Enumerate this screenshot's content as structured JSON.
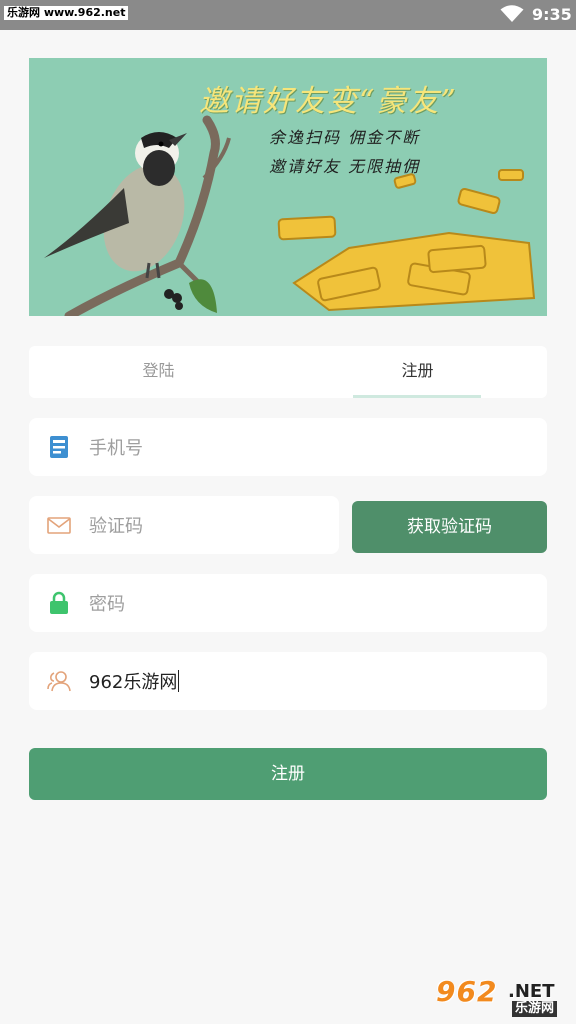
{
  "status_bar": {
    "watermark_text": "乐游网 www.962.net",
    "time": "9:35",
    "icons": [
      "wifi-icon"
    ]
  },
  "banner": {
    "title": "邀请好友变“豪友”",
    "line1": "余逸扫码 佣金不断",
    "line2": "邀请好友 无限抽佣",
    "colors": {
      "background": "#8dcdb3",
      "title": "#f6e57a"
    }
  },
  "tabs": [
    {
      "label": "登陆",
      "active": false
    },
    {
      "label": "注册",
      "active": true
    }
  ],
  "form": {
    "phone": {
      "placeholder": "手机号",
      "value": "",
      "icon": "phone-icon"
    },
    "code": {
      "placeholder": "验证码",
      "value": "",
      "icon": "mail-icon"
    },
    "password": {
      "placeholder": "密码",
      "value": "",
      "icon": "lock-icon"
    },
    "inviter": {
      "placeholder": "",
      "value": "962乐游网",
      "icon": "users-icon"
    },
    "get_code_label": "获取验证码",
    "submit_label": "注册"
  },
  "watermark": {
    "number": "962",
    "net": ".NET",
    "sub": "乐游网"
  },
  "colors": {
    "accent": "#4f9e73",
    "code_button": "#4f8f6a",
    "tab_indicator": "#cfe9df",
    "background": "#f7f7f7"
  }
}
